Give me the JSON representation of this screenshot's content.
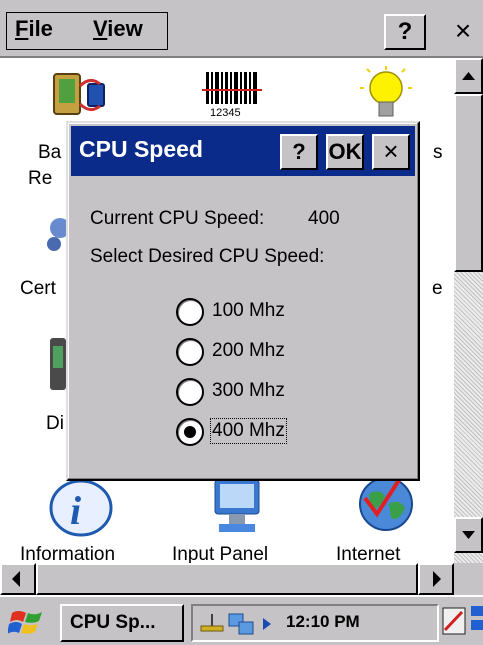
{
  "menubar": {
    "file_label": "File",
    "file_hotkey": "F",
    "file_rest": "ile",
    "view_label": "View",
    "view_hotkey": "V",
    "view_rest": "iew",
    "help_label": "?",
    "close_label": "×"
  },
  "desktop": {
    "icons": [
      {
        "name": "battery-icon",
        "label": "Ba"
      },
      {
        "name": "barcode-icon",
        "label": "",
        "barcode_text": "12345"
      },
      {
        "name": "lightbulb-icon",
        "label": "s"
      },
      {
        "name": "certificates-icon",
        "label": "Cert"
      },
      {
        "name": "unknown-icon-right",
        "label": "e"
      },
      {
        "name": "display-icon",
        "label": "Di"
      },
      {
        "name": "information-icon",
        "label": "Information"
      },
      {
        "name": "input-panel-icon",
        "label": "Input Panel"
      },
      {
        "name": "internet-icon",
        "label": "Internet"
      }
    ],
    "partial_labels": {
      "re": "Re"
    }
  },
  "dialog": {
    "title": "CPU Speed",
    "help_label": "?",
    "ok_label": "OK",
    "close_label": "×",
    "current_speed_label": "Current CPU Speed:",
    "current_speed_value": "400",
    "select_prompt": "Select Desired CPU Speed:",
    "options": [
      {
        "label": "100 Mhz",
        "selected": false
      },
      {
        "label": "200 Mhz",
        "selected": false
      },
      {
        "label": "300 Mhz",
        "selected": false
      },
      {
        "label": "400 Mhz",
        "selected": true
      }
    ]
  },
  "taskbar": {
    "task_label": "CPU Sp...",
    "clock": "12:10 PM"
  },
  "colors": {
    "titlebar": "#0b2b8b",
    "chrome": "#c6c3c6"
  }
}
